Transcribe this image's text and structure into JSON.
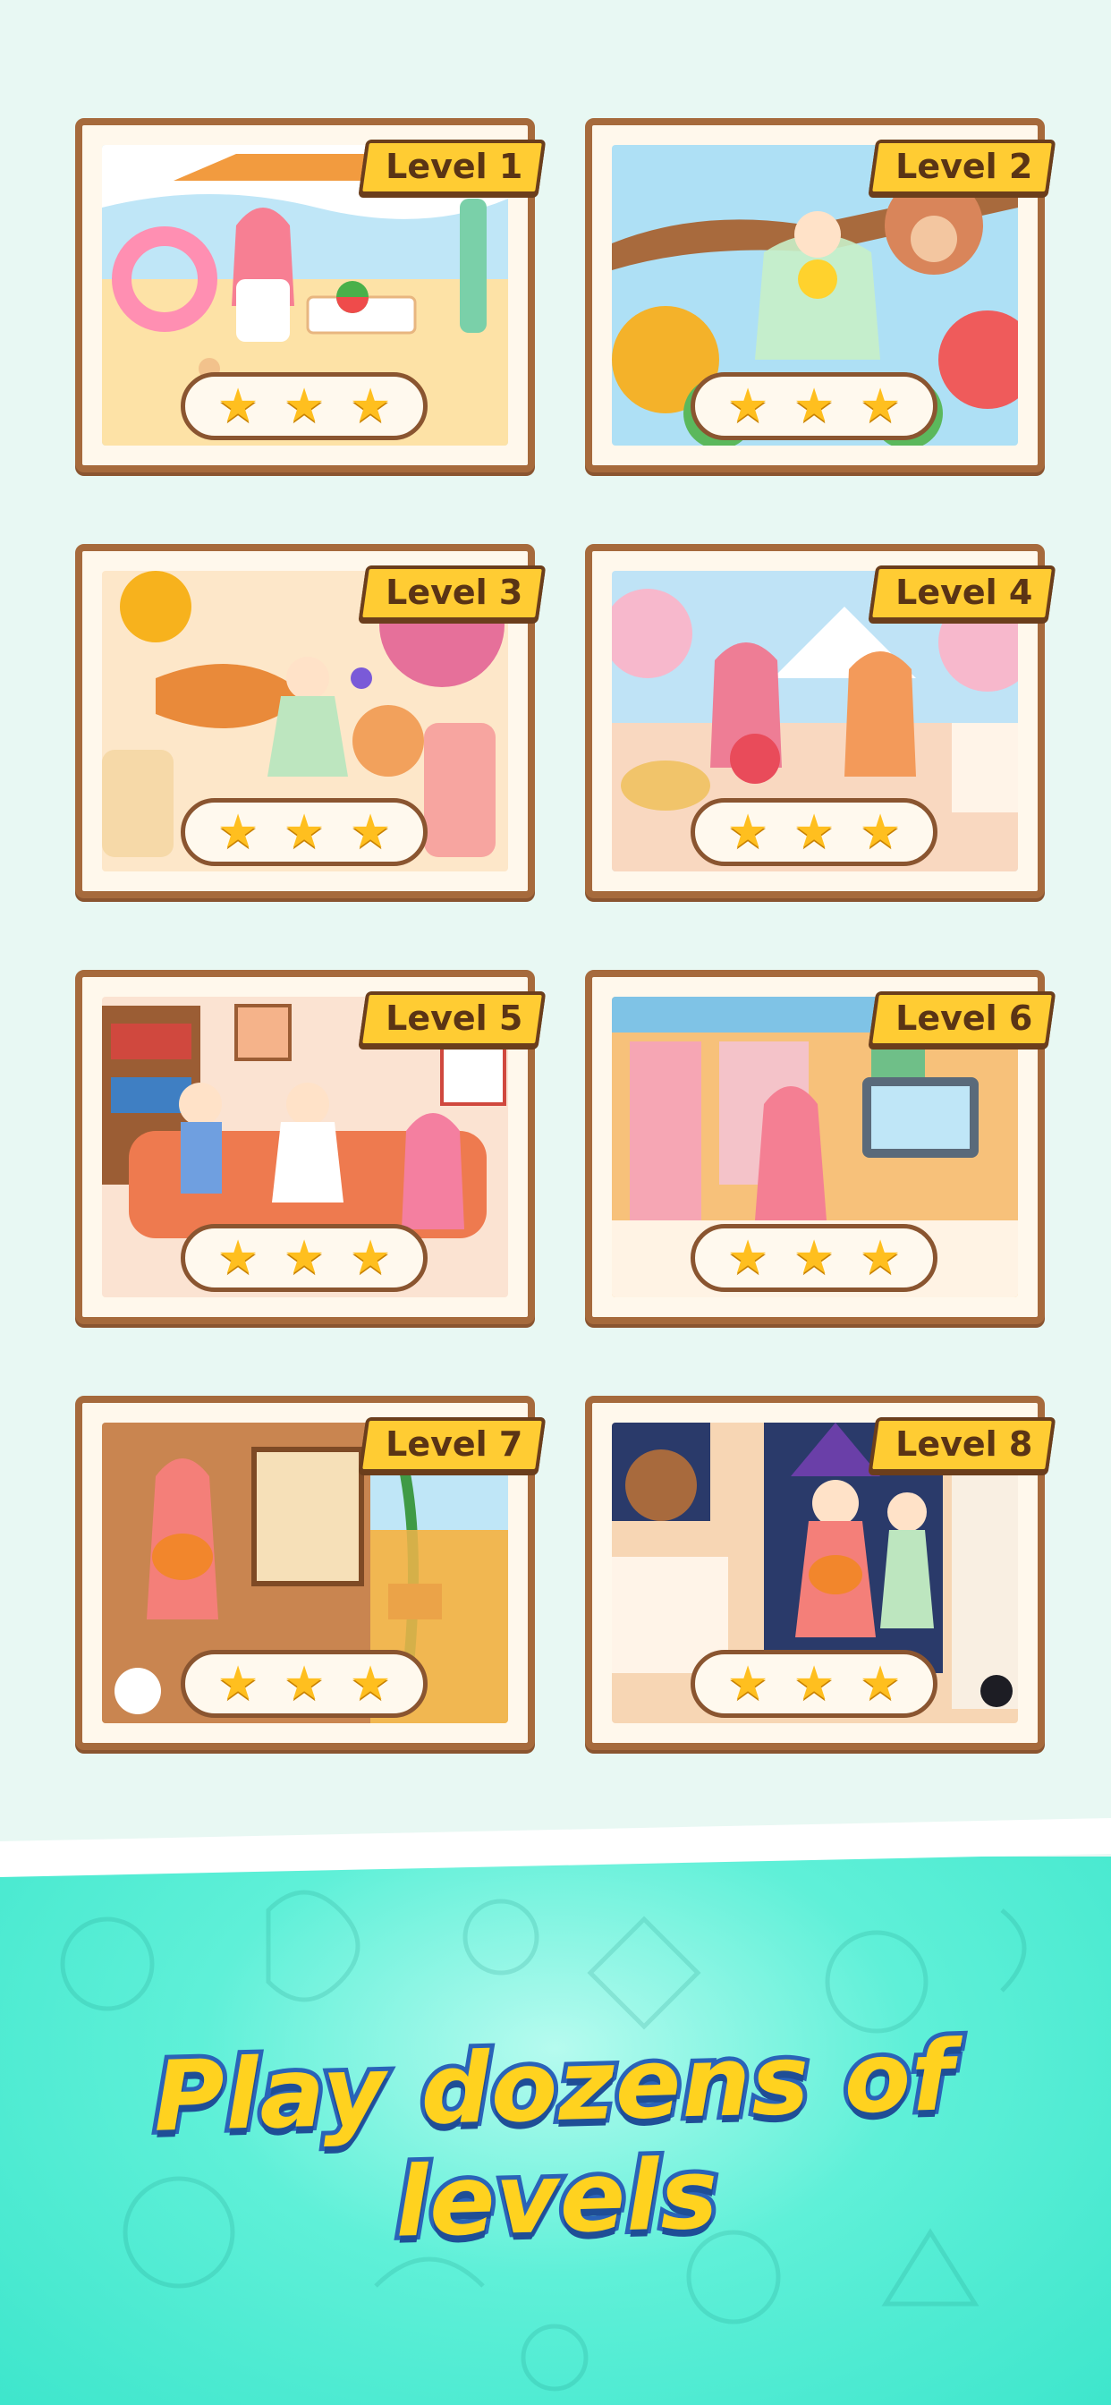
{
  "levels": [
    {
      "label": "Level 1",
      "stars": 3,
      "theme": "beach"
    },
    {
      "label": "Level 2",
      "stars": 3,
      "theme": "fairy-garden"
    },
    {
      "label": "Level 3",
      "stars": 3,
      "theme": "picnic"
    },
    {
      "label": "Level 4",
      "stars": 3,
      "theme": "mountain-picnic"
    },
    {
      "label": "Level 5",
      "stars": 3,
      "theme": "living-room"
    },
    {
      "label": "Level 6",
      "stars": 3,
      "theme": "subway-station"
    },
    {
      "label": "Level 7",
      "stars": 3,
      "theme": "farm-house"
    },
    {
      "label": "Level 8",
      "stars": 3,
      "theme": "halloween-door"
    }
  ],
  "star_glyph": "★",
  "banner": {
    "headline": "Play dozens of levels"
  },
  "colors": {
    "frame": "#a66a3c",
    "tag": "#ffcc33",
    "star": "#ffbf1f",
    "banner": "#5ff0d8",
    "headline_fill": "#ffd21f",
    "headline_stroke": "#2a63b8"
  }
}
